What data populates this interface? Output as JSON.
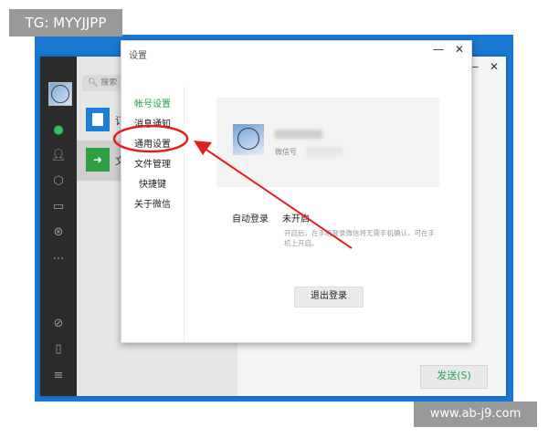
{
  "watermarks": {
    "top_left": "TG: MYYJJPP",
    "bottom_right": "www.ab-j9.com"
  },
  "main_window": {
    "search_placeholder": "搜索",
    "chat_items": [
      "订",
      "文"
    ],
    "send_button": "发送(S)",
    "sidebar_icons": [
      "chat-icon",
      "contacts-icon",
      "box-icon",
      "folder-icon",
      "moments-icon",
      "more-icon",
      "mini-program-icon",
      "phone-icon",
      "menu-icon"
    ]
  },
  "settings": {
    "title": "设置",
    "min_label": "—",
    "close_label": "✕",
    "menu": [
      {
        "label": "帐号设置",
        "active": true
      },
      {
        "label": "消息通知",
        "active": false
      },
      {
        "label": "通用设置",
        "active": false
      },
      {
        "label": "文件管理",
        "active": false
      },
      {
        "label": "快捷键",
        "active": false
      },
      {
        "label": "关于微信",
        "active": false
      }
    ],
    "profile": {
      "wechat_id_label": "微信号"
    },
    "auto_login": {
      "label": "自动登录",
      "value": "未开启",
      "description": "开启后，在手机登录微信将无需手机确认，可在手机上开启。"
    },
    "logout_button": "退出登录"
  },
  "colors": {
    "desktop_blue": "#1a78d2",
    "wechat_green": "#24a148",
    "annotation_red": "#e02020"
  }
}
